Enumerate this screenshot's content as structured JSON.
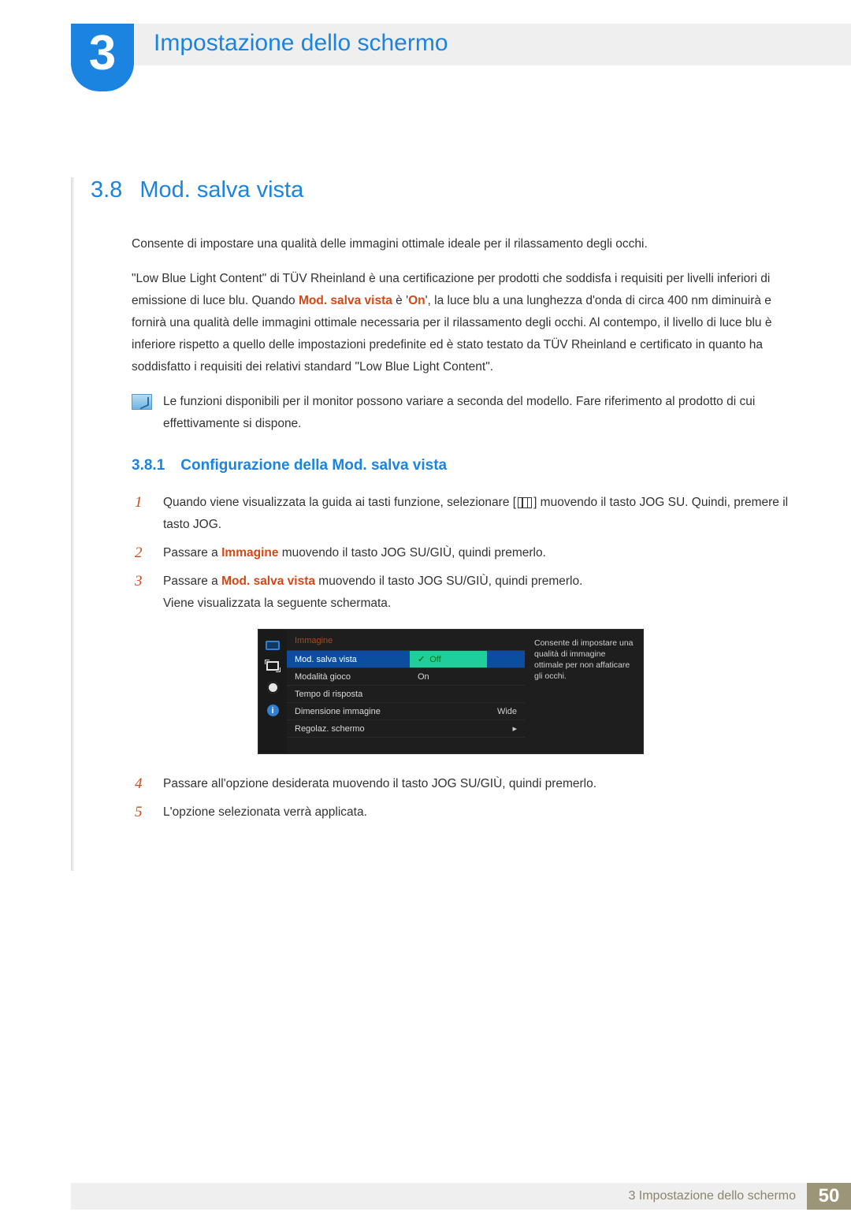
{
  "chapter": {
    "number": "3",
    "title": "Impostazione dello schermo"
  },
  "section": {
    "number": "3.8",
    "title": "Mod. salva vista"
  },
  "paras": {
    "p1": "Consente di impostare una qualità delle immagini ottimale ideale per il rilassamento degli occhi.",
    "p2a": "\"Low Blue Light Content\" di TÜV Rheinland è una certificazione per prodotti che soddisfa i requisiti per livelli inferiori di emissione di luce blu. Quando ",
    "p2hl1": "Mod. salva vista",
    "p2b": " è '",
    "p2hl2": "On",
    "p2c": "', la luce blu a una lunghezza d'onda di circa 400 nm diminuirà e fornirà una qualità delle immagini ottimale necessaria per il rilassamento degli occhi. Al contempo, il livello di luce blu è inferiore rispetto a quello delle impostazioni predefinite ed è stato testato da TÜV Rheinland e certificato in quanto ha soddisfatto i requisiti dei relativi standard \"Low Blue Light Content\"."
  },
  "note": "Le funzioni disponibili per il monitor possono variare a seconda del modello. Fare riferimento al prodotto di cui effettivamente si dispone.",
  "subsection": {
    "number": "3.8.1",
    "title": "Configurazione della Mod. salva vista"
  },
  "steps": {
    "s1a": "Quando viene visualizzata la guida ai tasti funzione, selezionare [",
    "s1b": "] muovendo il tasto JOG SU. Quindi, premere il tasto JOG.",
    "s2a": "Passare a ",
    "s2hl": "Immagine",
    "s2b": " muovendo il tasto JOG SU/GIÙ, quindi premerlo.",
    "s3a": "Passare a ",
    "s3hl": "Mod. salva vista",
    "s3b": " muovendo il tasto JOG SU/GIÙ, quindi premerlo.",
    "s3c": "Viene visualizzata la seguente schermata.",
    "s4": "Passare all'opzione desiderata muovendo il tasto JOG SU/GIÙ, quindi premerlo.",
    "s5": "L'opzione selezionata verrà applicata.",
    "n1": "1",
    "n2": "2",
    "n3": "3",
    "n4": "4",
    "n5": "5"
  },
  "osd": {
    "menuTitle": "Immagine",
    "items": {
      "eyeSaver": "Mod. salva vista",
      "gameMode": "Modalità gioco",
      "response": "Tempo di risposta",
      "imgSize": "Dimensione immagine",
      "imgSizeVal": "Wide",
      "screenAdj": "Regolaz. schermo",
      "arrow": "▸"
    },
    "options": {
      "off": "Off",
      "on": "On",
      "check": "✓"
    },
    "desc": "Consente di impostare una qualità di immagine ottimale per non affaticare gli occhi."
  },
  "footer": {
    "label": "3 Impostazione dello schermo",
    "page": "50"
  }
}
